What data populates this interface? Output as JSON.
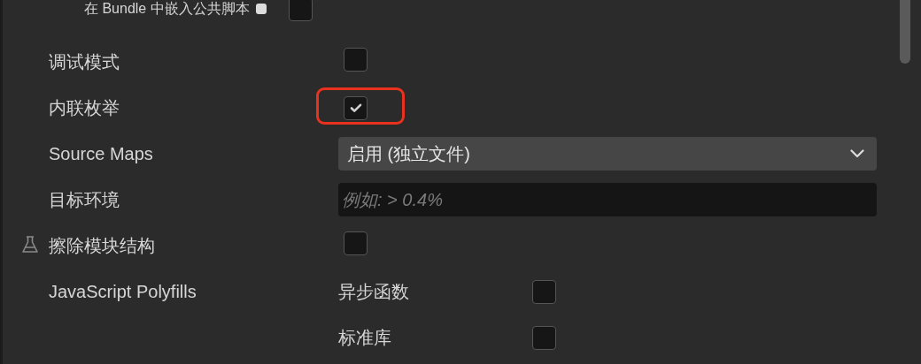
{
  "rows": [
    {
      "kind": "sub-checkbox",
      "label": "在 Bundle 中嵌入公共脚本",
      "locked": true,
      "checked": false,
      "highlighted": false
    },
    {
      "kind": "checkbox",
      "label": "调试模式",
      "checked": false,
      "highlighted": false
    },
    {
      "kind": "checkbox",
      "label": "内联枚举",
      "checked": true,
      "highlighted": true
    },
    {
      "kind": "select",
      "label": "Source Maps",
      "value": "启用 (独立文件)"
    },
    {
      "kind": "input",
      "label": "目标环境",
      "placeholder": "例如: > 0.4%"
    },
    {
      "kind": "checkbox",
      "label": "擦除模块结构",
      "experimental": true,
      "checked": false,
      "highlighted": false
    },
    {
      "kind": "options",
      "label": "JavaScript Polyfills",
      "options": [
        {
          "label": "异步函数",
          "checked": false
        },
        {
          "label": "标准库",
          "checked": false
        }
      ]
    }
  ]
}
